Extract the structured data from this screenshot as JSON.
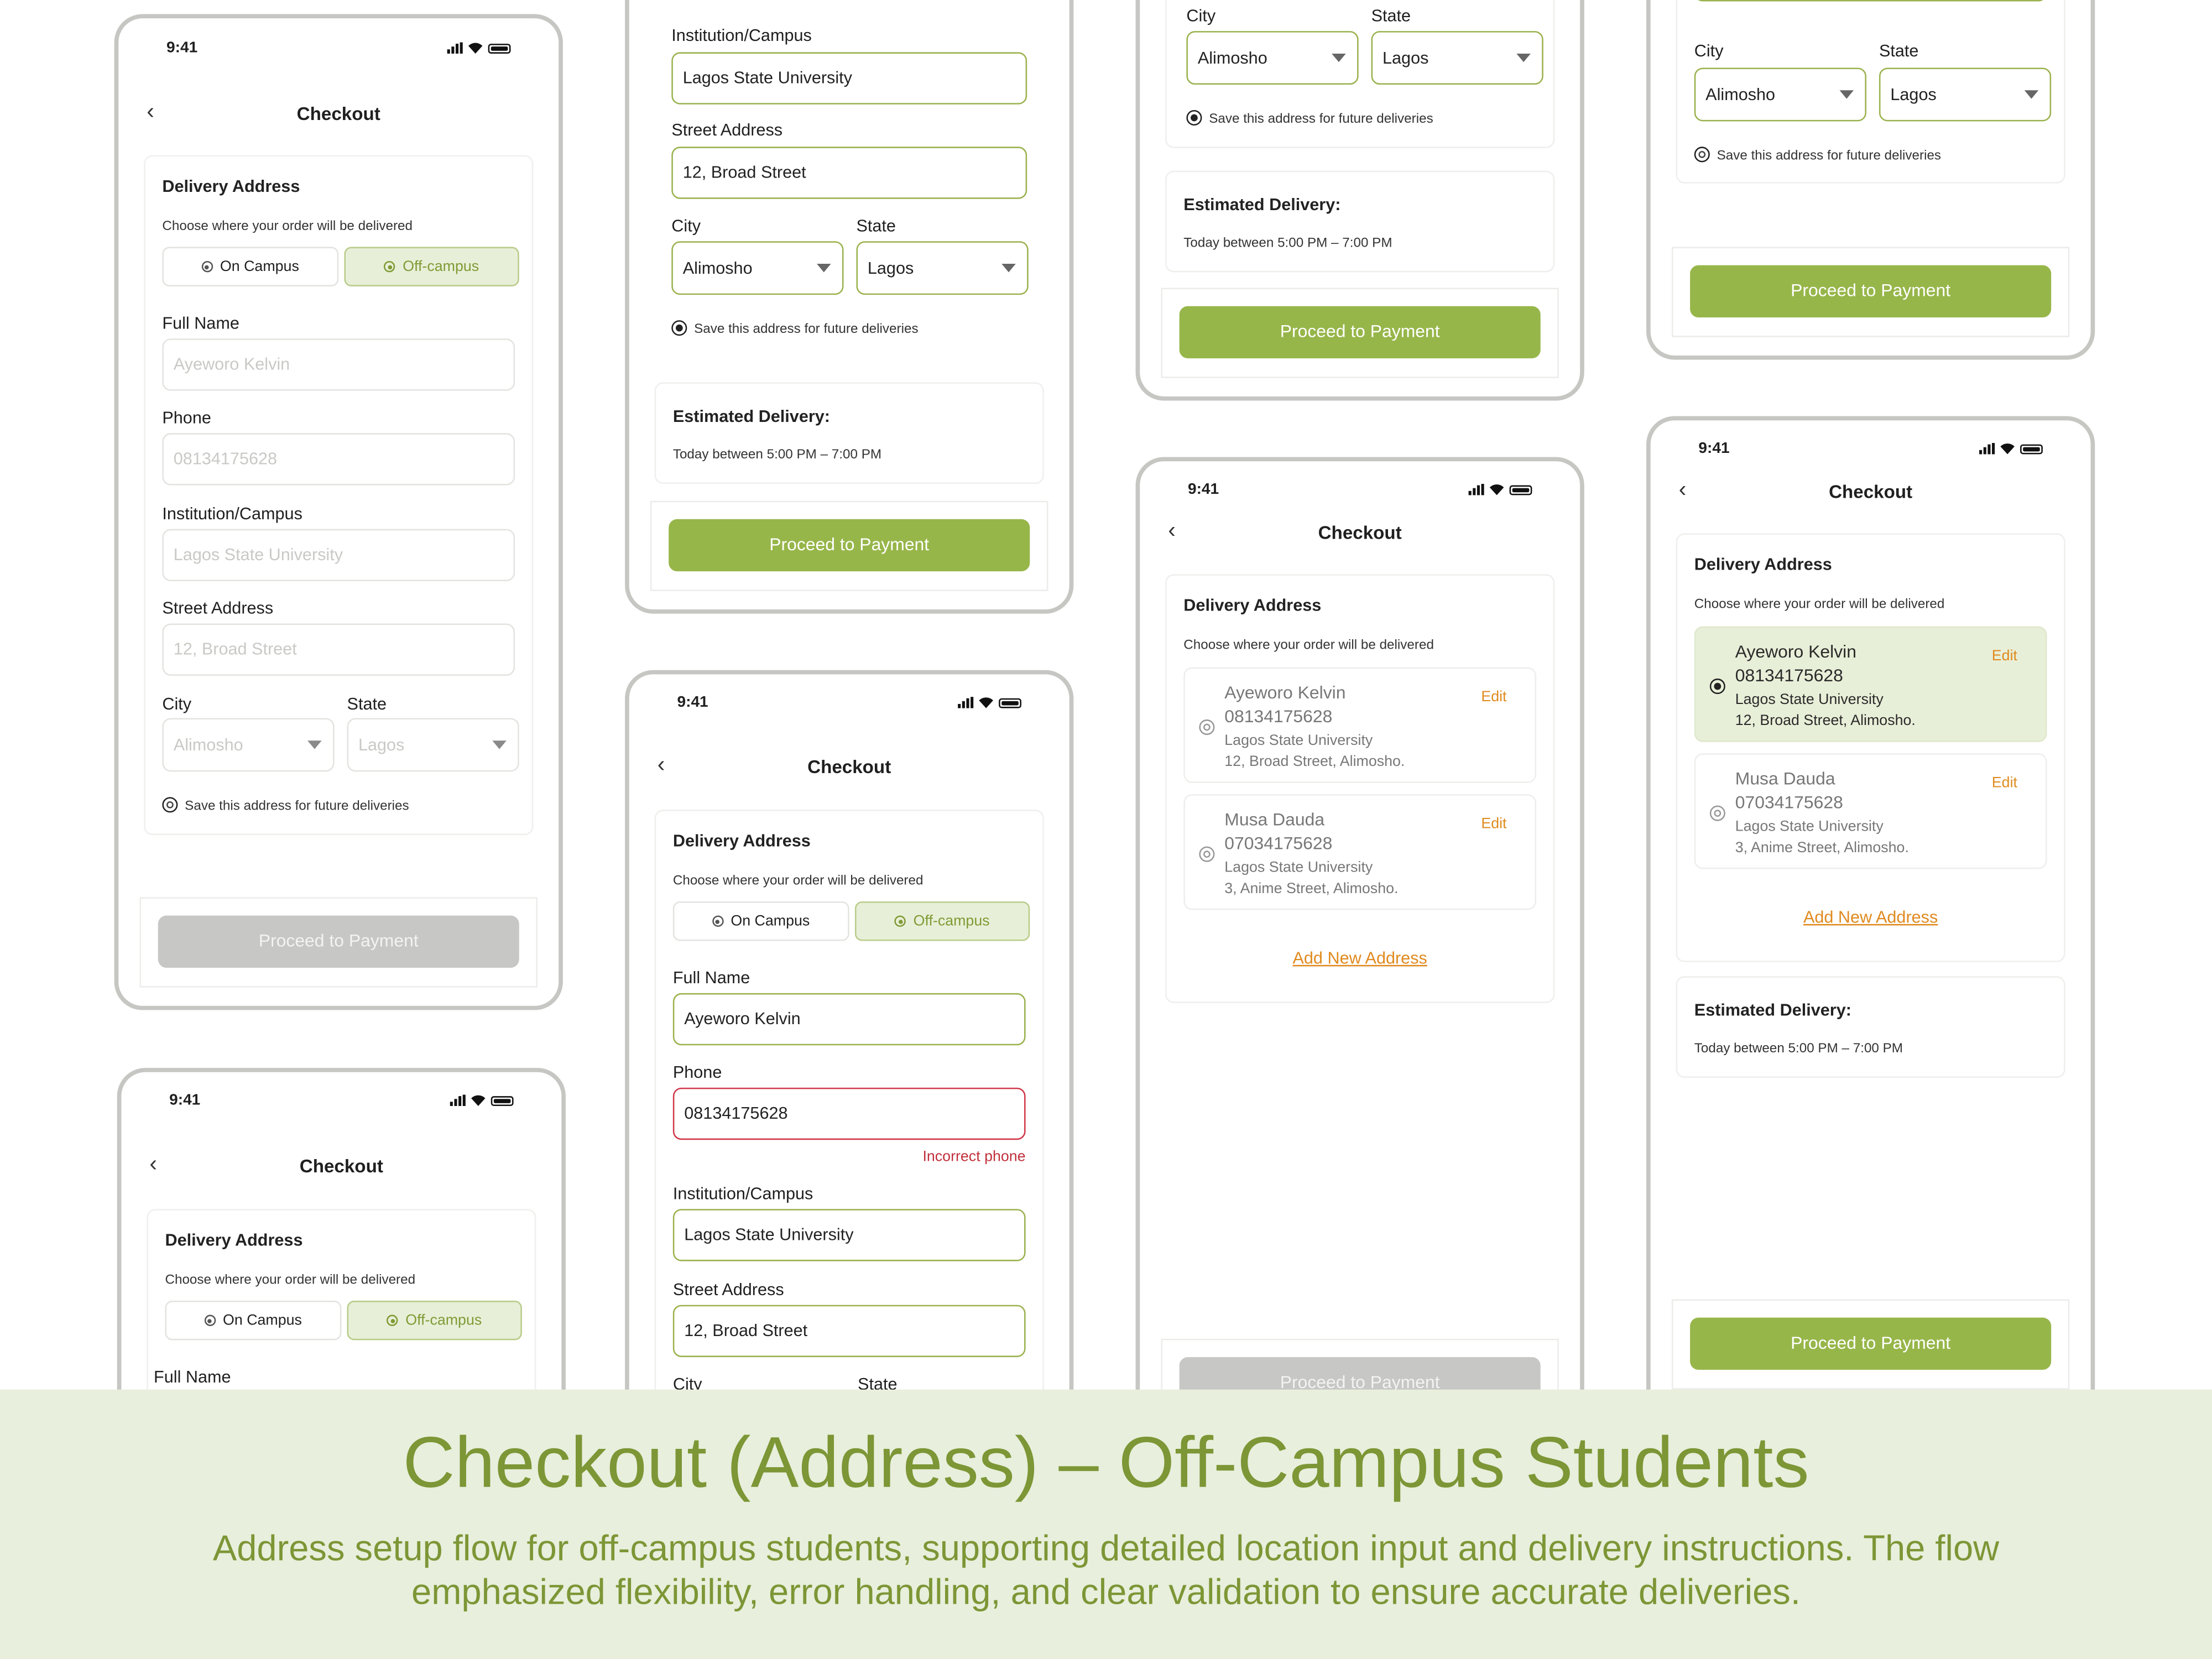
{
  "status_time": "9:41",
  "checkout": {
    "title": "Checkout",
    "back_icon": "chevron-left-icon",
    "delivery_heading": "Delivery Address",
    "delivery_sub": "Choose where your order will be delivered",
    "on_campus": "On Campus",
    "off_campus": "Off-campus",
    "full_name_label": "Full Name",
    "phone_label": "Phone",
    "institution_label": "Institution/Campus",
    "street_label": "Street Address",
    "city_label": "City",
    "state_label": "State",
    "full_name": "Ayeworo Kelvin",
    "phone": "08134175628",
    "institution": "Lagos  State University",
    "street": "12, Broad Street",
    "city": "Alimosho",
    "state": "Lagos",
    "save_address": "Save this address for future deliveries",
    "phone_error": "Incorrect phone",
    "estimated_heading": "Estimated Delivery:",
    "estimated_text": "Today between 5:00 PM – 7:00 PM",
    "proceed": "Proceed to Payment",
    "edit": "Edit",
    "add_new": "Add  New Address"
  },
  "saved_addresses": [
    {
      "name": "Ayeworo Kelvin",
      "phone": "08134175628",
      "institution": "Lagos  State University",
      "street": "12, Broad Street, Alimosho."
    },
    {
      "name": "Musa Dauda",
      "phone": "07034175628",
      "institution": "Lagos  State University",
      "street": "3, Anime Street, Alimosho."
    }
  ],
  "colors": {
    "accent": "#97b64a",
    "accent_text": "#7f9b35",
    "error": "#d0384a",
    "link": "#e08a1e",
    "disabled": "#c7c7c5",
    "banner_bg": "#e8efdc"
  },
  "banner": {
    "title": "Checkout (Address) – Off-Campus Students",
    "subtitle": "Address setup flow for off-campus students, supporting detailed location input and delivery instructions. The flow emphasized flexibility, error handling, and clear validation to ensure accurate deliveries."
  }
}
